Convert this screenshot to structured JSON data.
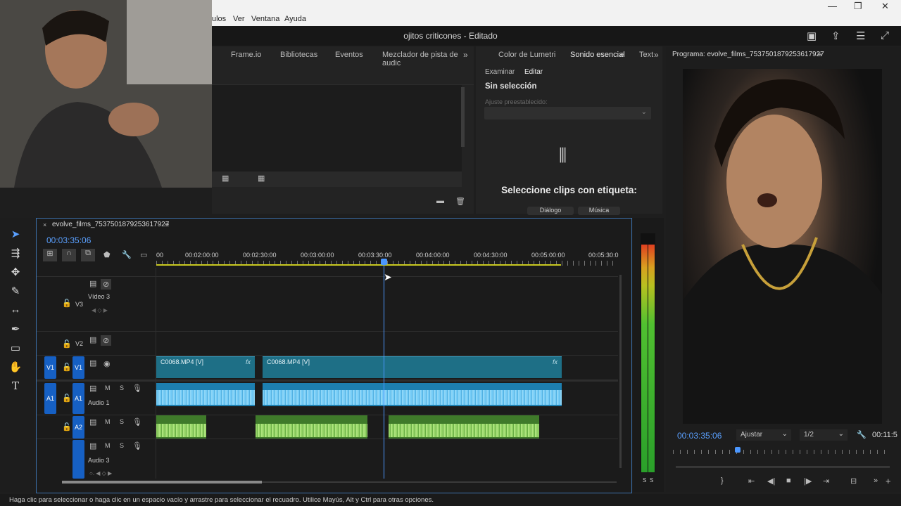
{
  "menu": {
    "items": [
      "ulos",
      "Ver",
      "Ventana",
      "Ayuda"
    ]
  },
  "title": "ojitos criticones - Editado",
  "top_tabs": [
    "Frame.io",
    "Bibliotecas",
    "Eventos",
    "Mezclador de pista de audic"
  ],
  "essential": {
    "tabs": [
      "Color de Lumetri",
      "Sonido esencial",
      "Text"
    ],
    "subtabs": [
      "Examinar",
      "Editar"
    ],
    "no_selection": "Sin selección",
    "preset_label": "Ajuste preestablecido:",
    "select_clips": "Seleccione clips con etiqueta:",
    "chips": [
      "Diálogo",
      "Música"
    ]
  },
  "program": {
    "title": "Programa: evolve_films_7537501879253617927",
    "timecode": "00:03:35:06",
    "fit": "Ajustar",
    "quality": "1/2",
    "duration": "00:11:5"
  },
  "timeline": {
    "sequence": "evolve_films_7537501879253617927",
    "timecode": "00:03:35:06",
    "ruler": [
      "00",
      "00:02:00:00",
      "00:02:30:00",
      "00:03:00:00",
      "00:03:30:00",
      "00:04:00:00",
      "00:04:30:00",
      "00:05:00:00",
      "00:05:30:0"
    ],
    "tracks": {
      "v3": "V3",
      "v3_name": "Vídeo 3",
      "v2": "V2",
      "v1": "V1",
      "v1_src": "V1",
      "a1": "A1",
      "a1_src": "A1",
      "a1_name": "Audio 1",
      "a2": "A2",
      "a3_name": "Audio 3",
      "m": "M",
      "s": "S"
    },
    "clips": {
      "video1": "C0068.MP4 [V]",
      "video2": "C0068.MP4 [V]",
      "fx": "fx"
    }
  },
  "meter": {
    "labels": [
      "S",
      "S"
    ]
  },
  "status": "Haga clic para seleccionar o haga clic en un espacio vacío y arrastre para seleccionar el recuadro. Utilice Mayús, Alt y Ctrl para otras opciones.",
  "colors": {
    "accent": "#3b8cff",
    "video_clip": "#1e6f86",
    "audio_clip": "#1d7fb0",
    "music_clip": "#3f7a2a"
  }
}
